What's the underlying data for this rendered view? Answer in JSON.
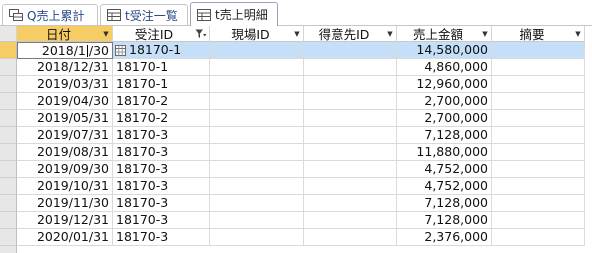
{
  "tabs": [
    {
      "label": "Q売上累計",
      "icon": "query-icon",
      "active": false
    },
    {
      "label": "t受注一覧",
      "icon": "table-icon",
      "active": false
    },
    {
      "label": "t売上明細",
      "icon": "table-icon",
      "active": true
    }
  ],
  "columns": [
    {
      "label": "日付",
      "sort_icon": "",
      "selected": true
    },
    {
      "label": "受注ID",
      "sort_icon": "filter-icon",
      "selected": false
    },
    {
      "label": "現場ID",
      "sort_icon": "",
      "selected": false
    },
    {
      "label": "得意先ID",
      "sort_icon": "",
      "selected": false
    },
    {
      "label": "売上金額",
      "sort_icon": "",
      "selected": false
    },
    {
      "label": "摘要",
      "sort_icon": "",
      "selected": false
    }
  ],
  "current_row_date": {
    "before_caret": "2018/1",
    "after_caret": "/30"
  },
  "rows": [
    {
      "date": "2018/11/30",
      "order_id": "18170-1",
      "site_id": "",
      "customer_id": "",
      "amount": "14,580,000",
      "note": ""
    },
    {
      "date": "2018/12/31",
      "order_id": "18170-1",
      "site_id": "",
      "customer_id": "",
      "amount": "4,860,000",
      "note": ""
    },
    {
      "date": "2019/03/31",
      "order_id": "18170-1",
      "site_id": "",
      "customer_id": "",
      "amount": "12,960,000",
      "note": ""
    },
    {
      "date": "2019/04/30",
      "order_id": "18170-2",
      "site_id": "",
      "customer_id": "",
      "amount": "2,700,000",
      "note": ""
    },
    {
      "date": "2019/05/31",
      "order_id": "18170-2",
      "site_id": "",
      "customer_id": "",
      "amount": "2,700,000",
      "note": ""
    },
    {
      "date": "2019/07/31",
      "order_id": "18170-3",
      "site_id": "",
      "customer_id": "",
      "amount": "7,128,000",
      "note": ""
    },
    {
      "date": "2019/08/31",
      "order_id": "18170-3",
      "site_id": "",
      "customer_id": "",
      "amount": "11,880,000",
      "note": ""
    },
    {
      "date": "2019/09/30",
      "order_id": "18170-3",
      "site_id": "",
      "customer_id": "",
      "amount": "4,752,000",
      "note": ""
    },
    {
      "date": "2019/10/31",
      "order_id": "18170-3",
      "site_id": "",
      "customer_id": "",
      "amount": "4,752,000",
      "note": ""
    },
    {
      "date": "2019/11/30",
      "order_id": "18170-3",
      "site_id": "",
      "customer_id": "",
      "amount": "7,128,000",
      "note": ""
    },
    {
      "date": "2019/12/31",
      "order_id": "18170-3",
      "site_id": "",
      "customer_id": "",
      "amount": "7,128,000",
      "note": ""
    },
    {
      "date": "2020/01/31",
      "order_id": "18170-3",
      "site_id": "",
      "customer_id": "",
      "amount": "2,376,000",
      "note": ""
    }
  ],
  "colors": {
    "selection": "#f6cd64",
    "row_highlight": "#c5dff8"
  }
}
